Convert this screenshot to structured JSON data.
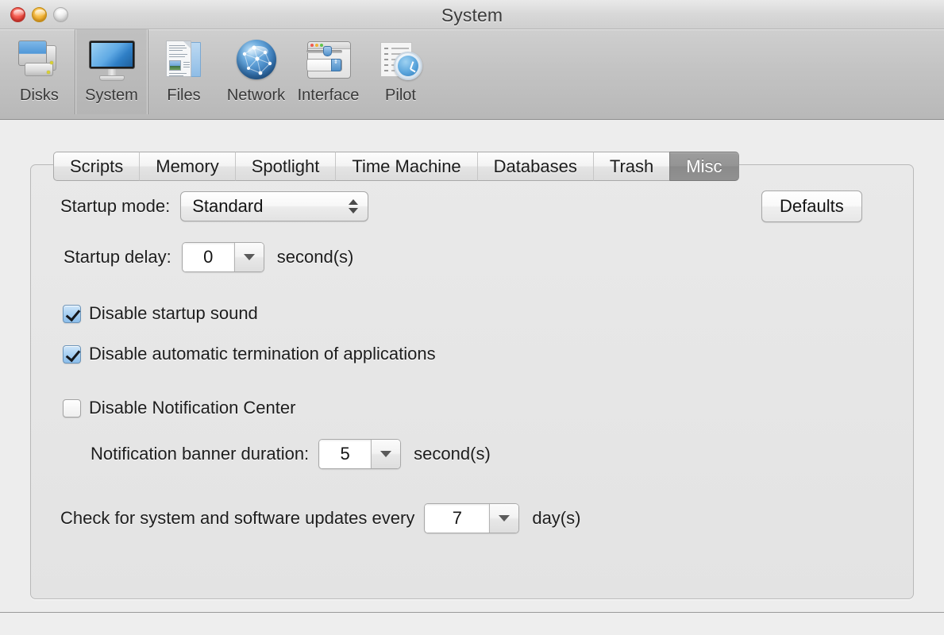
{
  "window": {
    "title": "System",
    "controls": {
      "close": "close-button",
      "minimize": "minimize-button",
      "zoom": "zoom-button"
    }
  },
  "toolbar": {
    "items": [
      {
        "label": "Disks",
        "icon": "disks-icon",
        "selected": false
      },
      {
        "label": "System",
        "icon": "monitor-icon",
        "selected": true
      },
      {
        "label": "Files",
        "icon": "documents-icon",
        "selected": false
      },
      {
        "label": "Network",
        "icon": "globe-icon",
        "selected": false
      },
      {
        "label": "Interface",
        "icon": "window-icon",
        "selected": false
      },
      {
        "label": "Pilot",
        "icon": "clock-icon",
        "selected": false
      }
    ]
  },
  "tabs": [
    {
      "label": "Scripts",
      "selected": false
    },
    {
      "label": "Memory",
      "selected": false
    },
    {
      "label": "Spotlight",
      "selected": false
    },
    {
      "label": "Time Machine",
      "selected": false
    },
    {
      "label": "Databases",
      "selected": false
    },
    {
      "label": "Trash",
      "selected": false
    },
    {
      "label": "Misc",
      "selected": true
    }
  ],
  "panel": {
    "startup_mode": {
      "label": "Startup mode:",
      "value": "Standard"
    },
    "defaults_button": {
      "label": "Defaults"
    },
    "startup_delay": {
      "label": "Startup delay:",
      "value": "0",
      "unit": "second(s)"
    },
    "disable_startup_sound": {
      "label": "Disable startup sound",
      "checked": true
    },
    "disable_auto_termination": {
      "label": "Disable automatic termination of applications",
      "checked": true
    },
    "disable_notification_center": {
      "label": "Disable Notification Center",
      "checked": false
    },
    "banner_duration": {
      "label": "Notification banner duration:",
      "value": "5",
      "unit": "second(s)"
    },
    "update_check": {
      "label": "Check for system and software updates every",
      "value": "7",
      "unit": "day(s)"
    }
  },
  "colors": {
    "accent": "#8bbdea",
    "selected_tab_bg": "#949494",
    "window_bg": "#ededed"
  }
}
